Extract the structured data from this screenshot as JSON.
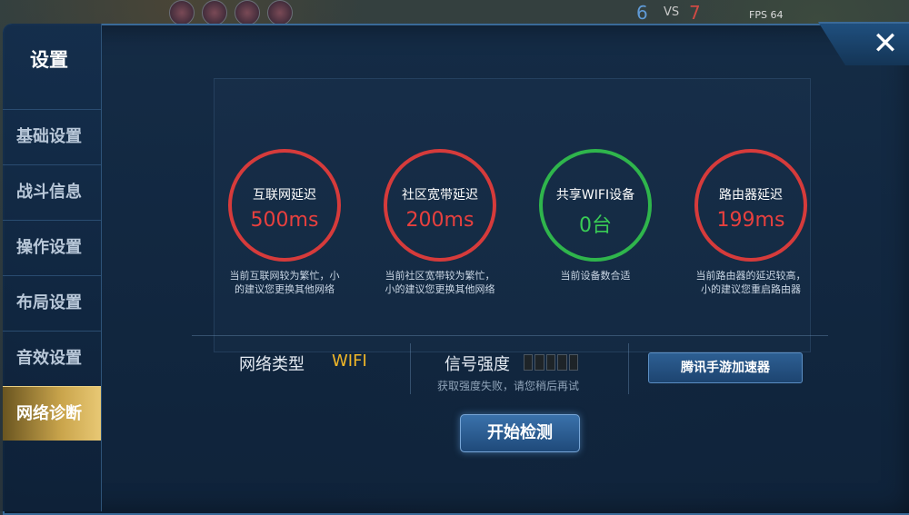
{
  "hud": {
    "score_left": "6",
    "vs": "VS",
    "score_right": "7",
    "fps": "FPS 64"
  },
  "sidebar": {
    "title": "设置",
    "items": [
      {
        "label": "基础设置"
      },
      {
        "label": "战斗信息"
      },
      {
        "label": "操作设置"
      },
      {
        "label": "布局设置"
      },
      {
        "label": "音效设置"
      },
      {
        "label": "网络诊断",
        "active": true
      }
    ]
  },
  "metrics": [
    {
      "label": "互联网延迟",
      "value": "500ms",
      "status": "bad",
      "note1": "当前互联网较为繁忙，小",
      "note2": "的建议您更换其他网络"
    },
    {
      "label": "社区宽带延迟",
      "value": "200ms",
      "status": "bad",
      "note1": "当前社区宽带较为繁忙，",
      "note2": "小的建议您更换其他网络"
    },
    {
      "label": "共享WIFI设备",
      "value": "0台",
      "status": "ok",
      "note1": "当前设备数合适",
      "note2": ""
    },
    {
      "label": "路由器延迟",
      "value": "199ms",
      "status": "bad",
      "note1": "当前路由器的延迟较高，",
      "note2": "小的建议您重启路由器"
    }
  ],
  "network": {
    "type_label": "网络类型",
    "type_value": "WIFI",
    "signal_label": "信号强度",
    "signal_bars_filled": 0,
    "signal_bars_total": 5,
    "signal_note": "获取强度失败，请您稍后再试",
    "accelerator_button": "腾讯手游加速器"
  },
  "actions": {
    "start_button": "开始检测",
    "close_icon": "close-icon"
  },
  "colors": {
    "bad": "#d63b3b",
    "ok": "#2fb54c",
    "active_tab": "#caa54c",
    "wifi_value": "#f0b628"
  }
}
